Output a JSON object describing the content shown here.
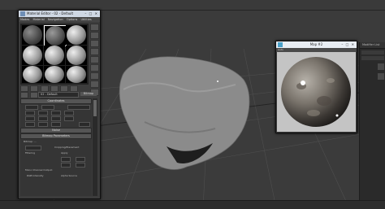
{
  "material_editor": {
    "title": "Material Editor - 02 - Default",
    "menu": [
      "Modes",
      "Material",
      "Navigation",
      "Options",
      "Utilities"
    ],
    "material_name": "02 - Default",
    "type_button": "Bitmap",
    "rollouts": [
      "Coordinates",
      "Noise",
      "Bitmap Parameters"
    ],
    "bitmap_path": "Bitmap: ...",
    "cropping_label": "Cropping/Placement",
    "filtering_label": "Filtering",
    "apply_label": "Apply",
    "alpha_source_label": "Alpha Source",
    "mono_channel_label": "Mono Channel Output:",
    "rgb_intensity": "RGB Intensity"
  },
  "map_window": {
    "title": "Map #2",
    "toolbar_label": "Auto"
  },
  "right_panel": {
    "header": "Modifier List"
  },
  "colors": {
    "viewport": "#3b3b3b",
    "grid": "#4d4d4d",
    "rock": "#8a8a8a",
    "titlebar": "#cfd8e4"
  }
}
